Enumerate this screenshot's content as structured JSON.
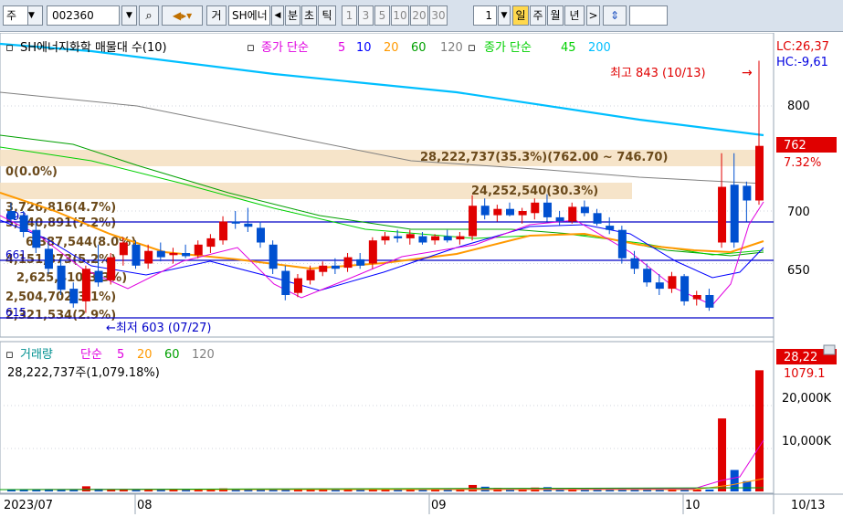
{
  "toolbar": {
    "market": "주",
    "code": "002360",
    "name": "SH에너",
    "view_mode": "거",
    "tabs": [
      "분",
      "초",
      "틱"
    ],
    "periods": [
      "1",
      "3",
      "5",
      "10",
      "20",
      "30"
    ],
    "period_input": "1",
    "timeframes": [
      "일",
      "주",
      "월",
      "년"
    ],
    "selected_timeframe": "일"
  },
  "legend": {
    "title": "SH에너지화학 매물대 수(10)",
    "ma_label": "종가 단순",
    "ma_periods": [
      "5",
      "10",
      "20",
      "60",
      "120"
    ],
    "ma2_label": "종가 단순",
    "ma2_periods": [
      "45",
      "200"
    ],
    "colors": {
      "5": "#e000e0",
      "10": "#0000ff",
      "20": "#ff9900",
      "60": "#00a000",
      "120": "#808080",
      "45": "#00d000",
      "200": "#00bfff"
    }
  },
  "price_panel": {
    "lc": "LC:26,37",
    "hc": "HC:-9,61",
    "high_note": "최고 843 (10/13)",
    "low_note": "최저 603 (07/27)",
    "current_price": "762",
    "current_change": "7.32%",
    "axis_labels": [
      "800",
      "700",
      "650"
    ],
    "left_labels": [
      "693",
      "661",
      "615"
    ],
    "volume_profile": [
      "28,222,737(35.3%)(762.00 ~ 746.70)",
      "0(0.0%)",
      "24,252,540(30.3%)",
      "3,726,816(4.7%)",
      "5,740,891(7.2%)",
      "6,387,544(8.0%)",
      "4,151,873(5.2%)",
      "2,625,410(3.3%)",
      "2,504,702(3.1%)",
      "2,321,534(2.9%)"
    ]
  },
  "volume_panel": {
    "title": "거래량",
    "ma_label": "단순",
    "ma_periods": [
      "5",
      "20",
      "60",
      "120"
    ],
    "info": "28,222,737주(1,079.18%)",
    "current": "28,22",
    "current_pct": "1079.1",
    "axis_labels": [
      "20,000K",
      "10,000K"
    ]
  },
  "x_axis": {
    "labels": [
      "2023/07",
      "08",
      "09",
      "10"
    ],
    "last_date": "10/13"
  },
  "chart_data": {
    "type": "candlestick",
    "price_range": [
      600,
      850
    ],
    "volume_range_k": [
      0,
      30000
    ],
    "candles": [
      {
        "o": 700,
        "h": 708,
        "l": 690,
        "c": 692,
        "v": 400
      },
      {
        "o": 696,
        "h": 700,
        "l": 675,
        "c": 680,
        "v": 450
      },
      {
        "o": 682,
        "h": 690,
        "l": 660,
        "c": 665,
        "v": 500
      },
      {
        "o": 664,
        "h": 672,
        "l": 640,
        "c": 645,
        "v": 550
      },
      {
        "o": 648,
        "h": 655,
        "l": 620,
        "c": 625,
        "v": 500
      },
      {
        "o": 626,
        "h": 632,
        "l": 608,
        "c": 612,
        "v": 450
      },
      {
        "o": 614,
        "h": 648,
        "l": 603,
        "c": 645,
        "v": 1200
      },
      {
        "o": 643,
        "h": 668,
        "l": 628,
        "c": 632,
        "v": 600
      },
      {
        "o": 634,
        "h": 660,
        "l": 630,
        "c": 656,
        "v": 500
      },
      {
        "o": 658,
        "h": 675,
        "l": 648,
        "c": 670,
        "v": 500
      },
      {
        "o": 668,
        "h": 672,
        "l": 645,
        "c": 648,
        "v": 450
      },
      {
        "o": 650,
        "h": 668,
        "l": 645,
        "c": 662,
        "v": 400
      },
      {
        "o": 662,
        "h": 670,
        "l": 652,
        "c": 656,
        "v": 380
      },
      {
        "o": 658,
        "h": 665,
        "l": 650,
        "c": 660,
        "v": 350
      },
      {
        "o": 660,
        "h": 668,
        "l": 655,
        "c": 657,
        "v": 330
      },
      {
        "o": 658,
        "h": 672,
        "l": 655,
        "c": 668,
        "v": 360
      },
      {
        "o": 666,
        "h": 678,
        "l": 660,
        "c": 674,
        "v": 380
      },
      {
        "o": 672,
        "h": 695,
        "l": 668,
        "c": 690,
        "v": 700
      },
      {
        "o": 690,
        "h": 700,
        "l": 683,
        "c": 688,
        "v": 500
      },
      {
        "o": 688,
        "h": 703,
        "l": 680,
        "c": 685,
        "v": 600
      },
      {
        "o": 684,
        "h": 690,
        "l": 665,
        "c": 670,
        "v": 450
      },
      {
        "o": 668,
        "h": 672,
        "l": 640,
        "c": 645,
        "v": 500
      },
      {
        "o": 643,
        "h": 648,
        "l": 615,
        "c": 620,
        "v": 550
      },
      {
        "o": 622,
        "h": 640,
        "l": 618,
        "c": 636,
        "v": 450
      },
      {
        "o": 634,
        "h": 648,
        "l": 630,
        "c": 644,
        "v": 400
      },
      {
        "o": 642,
        "h": 652,
        "l": 638,
        "c": 648,
        "v": 350
      },
      {
        "o": 648,
        "h": 655,
        "l": 640,
        "c": 645,
        "v": 330
      },
      {
        "o": 646,
        "h": 660,
        "l": 642,
        "c": 656,
        "v": 380
      },
      {
        "o": 654,
        "h": 660,
        "l": 645,
        "c": 648,
        "v": 350
      },
      {
        "o": 650,
        "h": 675,
        "l": 645,
        "c": 672,
        "v": 500
      },
      {
        "o": 672,
        "h": 680,
        "l": 668,
        "c": 676,
        "v": 450
      },
      {
        "o": 676,
        "h": 682,
        "l": 670,
        "c": 674,
        "v": 400
      },
      {
        "o": 674,
        "h": 682,
        "l": 668,
        "c": 678,
        "v": 420
      },
      {
        "o": 676,
        "h": 680,
        "l": 668,
        "c": 670,
        "v": 380
      },
      {
        "o": 672,
        "h": 678,
        "l": 668,
        "c": 676,
        "v": 360
      },
      {
        "o": 676,
        "h": 682,
        "l": 670,
        "c": 672,
        "v": 380
      },
      {
        "o": 673,
        "h": 680,
        "l": 668,
        "c": 676,
        "v": 400
      },
      {
        "o": 676,
        "h": 715,
        "l": 672,
        "c": 705,
        "v": 1500
      },
      {
        "o": 705,
        "h": 712,
        "l": 692,
        "c": 696,
        "v": 1100
      },
      {
        "o": 696,
        "h": 706,
        "l": 690,
        "c": 702,
        "v": 800
      },
      {
        "o": 702,
        "h": 708,
        "l": 695,
        "c": 696,
        "v": 600
      },
      {
        "o": 696,
        "h": 703,
        "l": 688,
        "c": 700,
        "v": 550
      },
      {
        "o": 698,
        "h": 712,
        "l": 692,
        "c": 708,
        "v": 900
      },
      {
        "o": 708,
        "h": 716,
        "l": 690,
        "c": 694,
        "v": 1000
      },
      {
        "o": 694,
        "h": 700,
        "l": 686,
        "c": 690,
        "v": 600
      },
      {
        "o": 690,
        "h": 708,
        "l": 688,
        "c": 704,
        "v": 700
      },
      {
        "o": 704,
        "h": 710,
        "l": 695,
        "c": 698,
        "v": 550
      },
      {
        "o": 698,
        "h": 702,
        "l": 686,
        "c": 688,
        "v": 500
      },
      {
        "o": 686,
        "h": 694,
        "l": 678,
        "c": 682,
        "v": 450
      },
      {
        "o": 682,
        "h": 686,
        "l": 650,
        "c": 655,
        "v": 550
      },
      {
        "o": 655,
        "h": 662,
        "l": 640,
        "c": 645,
        "v": 500
      },
      {
        "o": 645,
        "h": 650,
        "l": 628,
        "c": 632,
        "v": 450
      },
      {
        "o": 632,
        "h": 640,
        "l": 620,
        "c": 626,
        "v": 400
      },
      {
        "o": 626,
        "h": 642,
        "l": 622,
        "c": 638,
        "v": 380
      },
      {
        "o": 638,
        "h": 640,
        "l": 610,
        "c": 614,
        "v": 500
      },
      {
        "o": 616,
        "h": 624,
        "l": 610,
        "c": 620,
        "v": 400
      },
      {
        "o": 620,
        "h": 626,
        "l": 605,
        "c": 608,
        "v": 450
      },
      {
        "o": 670,
        "h": 755,
        "l": 665,
        "c": 723,
        "v": 17000
      },
      {
        "o": 725,
        "h": 755,
        "l": 665,
        "c": 670,
        "v": 5000
      },
      {
        "o": 724,
        "h": 728,
        "l": 690,
        "c": 710,
        "v": 2400
      },
      {
        "o": 710,
        "h": 843,
        "l": 706,
        "c": 762,
        "v": 28223
      }
    ]
  }
}
